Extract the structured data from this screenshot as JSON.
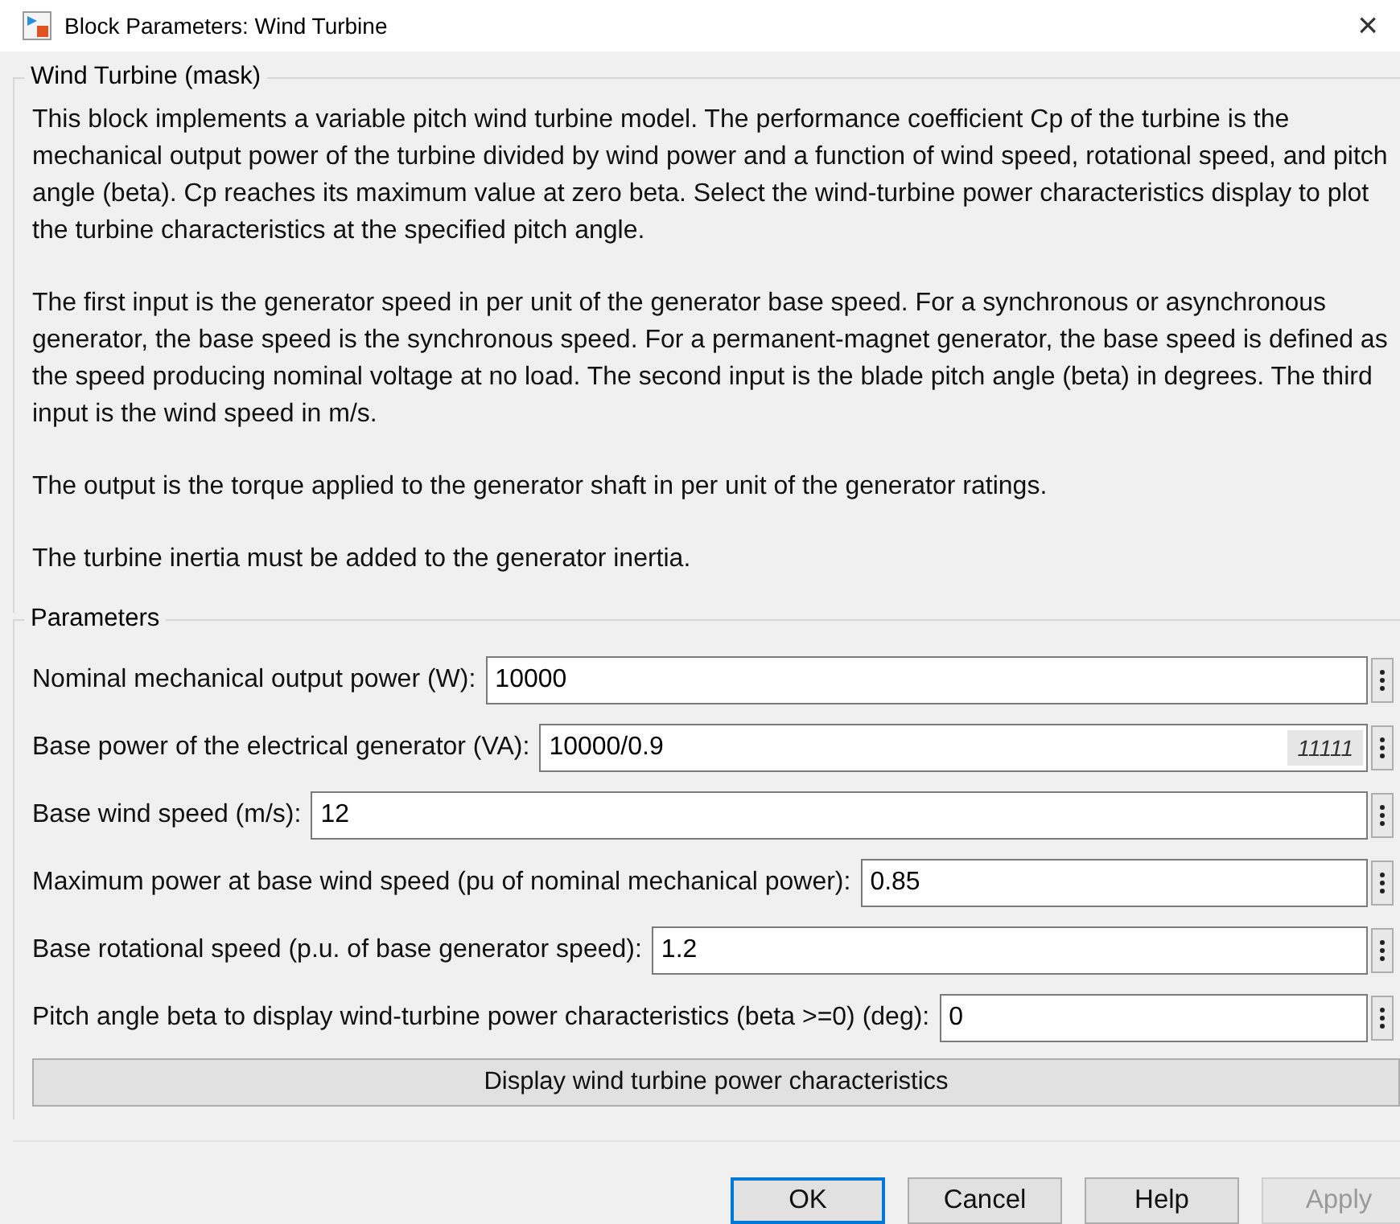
{
  "window": {
    "title": "Block Parameters: Wind Turbine",
    "close": "×"
  },
  "mask": {
    "title": "Wind Turbine (mask)",
    "paragraphs": [
      "This block implements a variable pitch wind turbine model. The performance coefficient Cp of the turbine is the mechanical output power of the turbine divided by wind power and a function of wind speed, rotational speed, and pitch angle (beta). Cp reaches its maximum value at zero beta. Select the wind-turbine power characteristics display to plot the turbine characteristics at the specified pitch angle.",
      "The first input is the generator speed in per unit of the generator base speed. For a synchronous or asynchronous generator, the base speed is the synchronous speed. For a permanent-magnet generator, the base speed is defined as the speed producing nominal voltage at  no load. The second input is the blade pitch angle (beta) in degrees. The third input is the wind speed in m/s.",
      "The output is the torque applied to the generator shaft in per unit of the generator ratings.",
      "The turbine inertia must be added to the generator inertia."
    ]
  },
  "parameters": {
    "title": "Parameters",
    "rows": [
      {
        "label": "Nominal mechanical output power (W):",
        "value": "10000"
      },
      {
        "label": "Base power of the electrical generator (VA):",
        "value": "10000/0.9",
        "evaluated": "11111"
      },
      {
        "label": "Base wind speed (m/s):",
        "value": "12"
      },
      {
        "label": "Maximum power at base wind speed (pu of nominal mechanical power):",
        "value": "0.85"
      },
      {
        "label": "Base rotational speed (p.u. of base generator speed):",
        "value": "1.2"
      },
      {
        "label": "Pitch angle beta to display wind-turbine power characteristics (beta >=0)  (deg):",
        "value": "0"
      }
    ],
    "action": "Display wind turbine power characteristics"
  },
  "buttons": [
    {
      "label": "OK",
      "default": true,
      "disabled": false
    },
    {
      "label": "Cancel",
      "default": false,
      "disabled": false
    },
    {
      "label": "Help",
      "default": false,
      "disabled": false
    },
    {
      "label": "Apply",
      "default": false,
      "disabled": true
    }
  ]
}
